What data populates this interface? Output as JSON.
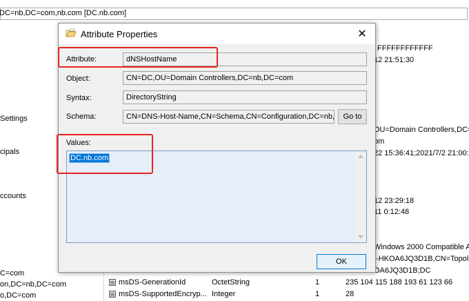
{
  "background": {
    "path": "DC=nb,DC=com,nb.com [DC.nb.com]",
    "left_items": [
      "Settings",
      "cipals",
      "ccounts"
    ],
    "left_bottom": [
      "C=com",
      "on,DC=nb,DC=com",
      "o,DC=com"
    ],
    "right_values": [
      "FFFFFFFFFFFF",
      "12 21:51:30",
      "OU=Domain Controllers,DC=",
      "om",
      "22 15:36:41;2021/7/2 21:00:",
      "12 23:29:18",
      "11 0:12:48",
      "Windows 2000 Compatible A",
      "I-HKOA6JQ3D1B,CN=Topolog",
      "OA6JQ3D1B;DC"
    ],
    "rows": [
      {
        "name": "msDS-GenerationId",
        "syntax": "OctetString",
        "count": "1",
        "value": "235 104 115 188 193 61 123 66"
      },
      {
        "name": "msDS-SupportedEncryp...",
        "syntax": "Integer",
        "count": "1",
        "value": "28"
      }
    ]
  },
  "dialog": {
    "title": "Attribute Properties",
    "title_icon": "folder-open-icon",
    "close_glyph": "✕",
    "labels": {
      "attribute": "Attribute:",
      "object": "Object:",
      "syntax": "Syntax:",
      "schema": "Schema:",
      "values": "Values:"
    },
    "fields": {
      "attribute": "dNSHostName",
      "object": "CN=DC,OU=Domain Controllers,DC=nb,DC=com",
      "syntax": "DirectoryString",
      "schema": "CN=DNS-Host-Name,CN=Schema,CN=Configuration,DC=nb,DC=com"
    },
    "goto_label": "Go to",
    "values": [
      "DC.nb.com"
    ],
    "ok_label": "OK"
  },
  "colors": {
    "highlight_border": "#e8231f",
    "selection": "#0078d7",
    "values_bg": "#e6eef8"
  }
}
